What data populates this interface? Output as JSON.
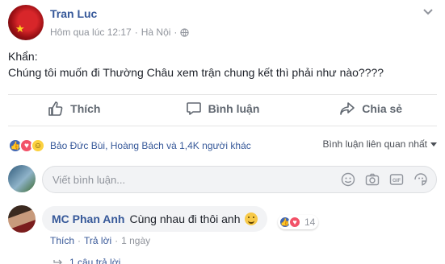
{
  "post": {
    "author": "Tran Luc",
    "time": "Hôm qua lúc 12:17",
    "separator": "·",
    "location": "Hà Nội",
    "text_line1": "Khẩn:",
    "text_line2": "Chúng tôi muốn đi Thường Châu xem trận chung kết thì phải như nào????"
  },
  "actions": {
    "like": "Thích",
    "comment": "Bình luận",
    "share": "Chia sẻ"
  },
  "reactions": {
    "summary": "Bảo Đức Bùi, Hoàng Bách và 1,4K người khác",
    "sort_label": "Bình luận liên quan nhất",
    "colors": {
      "like": "#4267b2",
      "love": "#f25268",
      "haha": "#fcd13f"
    }
  },
  "composer": {
    "placeholder": "Viết bình luận...",
    "icons": [
      "emoji-icon",
      "camera-icon",
      "gif-icon",
      "sticker-icon"
    ]
  },
  "comment": {
    "author": "MC Phan Anh",
    "text": "Cùng nhau đi thôi anh",
    "reaction_count": "14",
    "like_link": "Thích",
    "dot": "·",
    "reply_link": "Trả lời",
    "time": "1 ngày",
    "replies": "1 câu trả lời"
  }
}
